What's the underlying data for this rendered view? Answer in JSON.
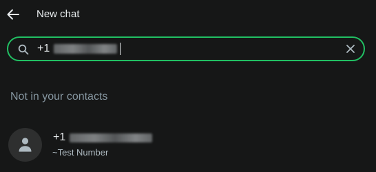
{
  "header": {
    "title": "New chat",
    "back_icon": "arrow-left-icon"
  },
  "search": {
    "value_prefix": "+1",
    "value_redacted": true,
    "accent_color": "#21c063",
    "leading_icon": "search-icon",
    "trailing_icon": "close-icon"
  },
  "section": {
    "label": "Not in your contacts"
  },
  "contact": {
    "number_prefix": "+1",
    "number_redacted": true,
    "subtitle": "~Test Number",
    "avatar_icon": "person-icon"
  },
  "colors": {
    "background": "#161717",
    "text_primary": "#e9edef",
    "text_secondary": "#8696a0",
    "avatar_bg": "#2e2f2f"
  }
}
